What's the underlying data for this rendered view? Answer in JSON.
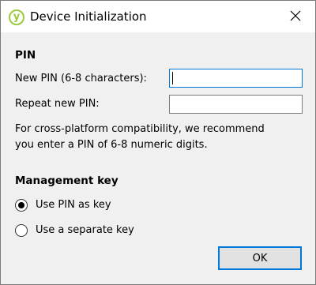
{
  "window": {
    "title": "Device Initialization",
    "icon": "yubico-logo-icon",
    "icon_letter": "y",
    "close_icon": "close-icon"
  },
  "pin_section": {
    "title": "PIN",
    "new_pin_label": "New PIN (6-8 characters):",
    "new_pin_value": "",
    "repeat_pin_label": "Repeat new PIN:",
    "repeat_pin_value": "",
    "info_line_1": "For cross-platform compatibility, we recommend",
    "info_line_2": "you enter a PIN of 6-8 numeric digits."
  },
  "management_key_section": {
    "title": "Management key",
    "options": [
      {
        "label": "Use PIN as key",
        "selected": true
      },
      {
        "label": "Use a separate key",
        "selected": false
      }
    ]
  },
  "buttons": {
    "ok_label": "OK"
  },
  "colors": {
    "accent": "#0078d7",
    "logo": "#9aca3c",
    "dialog_background": "#f0f0f0",
    "titlebar_background": "#ffffff"
  }
}
